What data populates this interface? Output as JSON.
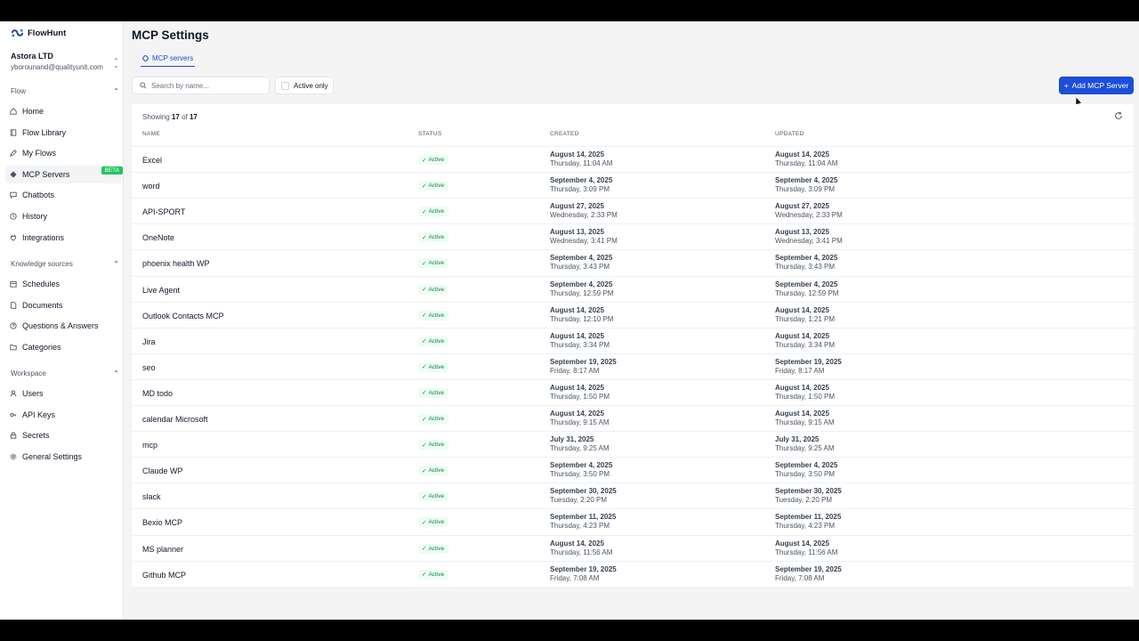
{
  "brand": {
    "name": "FlowHunt"
  },
  "org": {
    "name": "Astora LTD",
    "email": "yborounand@qualityunit.com"
  },
  "sidebar": {
    "sections": [
      {
        "title": "Flow",
        "items": [
          {
            "label": "Home",
            "icon": "home-icon"
          },
          {
            "label": "Flow Library",
            "icon": "book-icon"
          },
          {
            "label": "My Flows",
            "icon": "edit-icon"
          },
          {
            "label": "MCP Servers",
            "icon": "diamond-icon",
            "badge": "BETA",
            "active": true
          },
          {
            "label": "Chatbots",
            "icon": "chat-icon"
          },
          {
            "label": "History",
            "icon": "clock-icon"
          },
          {
            "label": "Integrations",
            "icon": "plug-icon"
          }
        ]
      },
      {
        "title": "Knowledge sources",
        "items": [
          {
            "label": "Schedules",
            "icon": "calendar-icon"
          },
          {
            "label": "Documents",
            "icon": "document-icon"
          },
          {
            "label": "Questions & Answers",
            "icon": "question-icon"
          },
          {
            "label": "Categories",
            "icon": "folder-icon"
          }
        ]
      },
      {
        "title": "Workspace",
        "items": [
          {
            "label": "Users",
            "icon": "user-icon"
          },
          {
            "label": "API Keys",
            "icon": "key-icon"
          },
          {
            "label": "Secrets",
            "icon": "lock-icon"
          },
          {
            "label": "General Settings",
            "icon": "gear-icon"
          }
        ]
      }
    ]
  },
  "page": {
    "title": "MCP Settings"
  },
  "tabs": [
    {
      "label": "MCP servers",
      "active": true
    }
  ],
  "search": {
    "placeholder": "Search by name...",
    "value": ""
  },
  "filter": {
    "label": "Active only",
    "checked": false
  },
  "add_button": {
    "label": "Add MCP Server"
  },
  "summary": {
    "prefix": "Showing",
    "shown": "17",
    "of": "of",
    "total": "17"
  },
  "columns": [
    "NAME",
    "STATUS",
    "CREATED",
    "UPDATED"
  ],
  "rows": [
    {
      "name": "Excel",
      "status": "Active",
      "created": [
        "August 14, 2025",
        "Thursday, 11:04 AM"
      ],
      "updated": [
        "August 14, 2025",
        "Thursday, 11:04 AM"
      ]
    },
    {
      "name": "word",
      "status": "Active",
      "created": [
        "September 4, 2025",
        "Thursday, 3:09 PM"
      ],
      "updated": [
        "September 4, 2025",
        "Thursday, 3:09 PM"
      ]
    },
    {
      "name": "API-SPORT",
      "status": "Active",
      "created": [
        "August 27, 2025",
        "Wednesday, 2:33 PM"
      ],
      "updated": [
        "August 27, 2025",
        "Wednesday, 2:33 PM"
      ]
    },
    {
      "name": "OneNote",
      "status": "Active",
      "created": [
        "August 13, 2025",
        "Wednesday, 3:41 PM"
      ],
      "updated": [
        "August 13, 2025",
        "Wednesday, 3:41 PM"
      ]
    },
    {
      "name": "phoenix health WP",
      "status": "Active",
      "created": [
        "September 4, 2025",
        "Thursday, 3:43 PM"
      ],
      "updated": [
        "September 4, 2025",
        "Thursday, 3:43 PM"
      ]
    },
    {
      "name": "Live Agent",
      "status": "Active",
      "created": [
        "September 4, 2025",
        "Thursday, 12:59 PM"
      ],
      "updated": [
        "September 4, 2025",
        "Thursday, 12:59 PM"
      ]
    },
    {
      "name": "Outlook Contacts MCP",
      "status": "Active",
      "created": [
        "August 14, 2025",
        "Thursday, 12:10 PM"
      ],
      "updated": [
        "August 14, 2025",
        "Thursday, 1:21 PM"
      ]
    },
    {
      "name": "Jira",
      "status": "Active",
      "created": [
        "August 14, 2025",
        "Thursday, 3:34 PM"
      ],
      "updated": [
        "August 14, 2025",
        "Thursday, 3:34 PM"
      ]
    },
    {
      "name": "seo",
      "status": "Active",
      "created": [
        "September 19, 2025",
        "Friday, 8:17 AM"
      ],
      "updated": [
        "September 19, 2025",
        "Friday, 8:17 AM"
      ]
    },
    {
      "name": "MD todo",
      "status": "Active",
      "created": [
        "August 14, 2025",
        "Thursday, 1:50 PM"
      ],
      "updated": [
        "August 14, 2025",
        "Thursday, 1:50 PM"
      ]
    },
    {
      "name": "calendar Microsoft",
      "status": "Active",
      "created": [
        "August 14, 2025",
        "Thursday, 9:15 AM"
      ],
      "updated": [
        "August 14, 2025",
        "Thursday, 9:15 AM"
      ]
    },
    {
      "name": "mcp",
      "status": "Active",
      "created": [
        "July 31, 2025",
        "Thursday, 9:25 AM"
      ],
      "updated": [
        "July 31, 2025",
        "Thursday, 9:25 AM"
      ]
    },
    {
      "name": "Claude WP",
      "status": "Active",
      "created": [
        "September 4, 2025",
        "Thursday, 3:50 PM"
      ],
      "updated": [
        "September 4, 2025",
        "Thursday, 3:50 PM"
      ]
    },
    {
      "name": "slack",
      "status": "Active",
      "created": [
        "September 30, 2025",
        "Tuesday, 2:20 PM"
      ],
      "updated": [
        "September 30, 2025",
        "Tuesday, 2:20 PM"
      ]
    },
    {
      "name": "Bexio MCP",
      "status": "Active",
      "created": [
        "September 11, 2025",
        "Thursday, 4:23 PM"
      ],
      "updated": [
        "September 11, 2025",
        "Thursday, 4:23 PM"
      ]
    },
    {
      "name": "MS planner",
      "status": "Active",
      "created": [
        "August 14, 2025",
        "Thursday, 11:56 AM"
      ],
      "updated": [
        "August 14, 2025",
        "Thursday, 11:56 AM"
      ]
    },
    {
      "name": "Github MCP",
      "status": "Active",
      "created": [
        "September 19, 2025",
        "Friday, 7:08 AM"
      ],
      "updated": [
        "September 19, 2025",
        "Friday, 7:08 AM"
      ]
    }
  ],
  "colors": {
    "accent": "#1d4ed8",
    "beta": "#22c55e",
    "status_bg": "#ecfdf3",
    "status_text": "#15803d"
  }
}
